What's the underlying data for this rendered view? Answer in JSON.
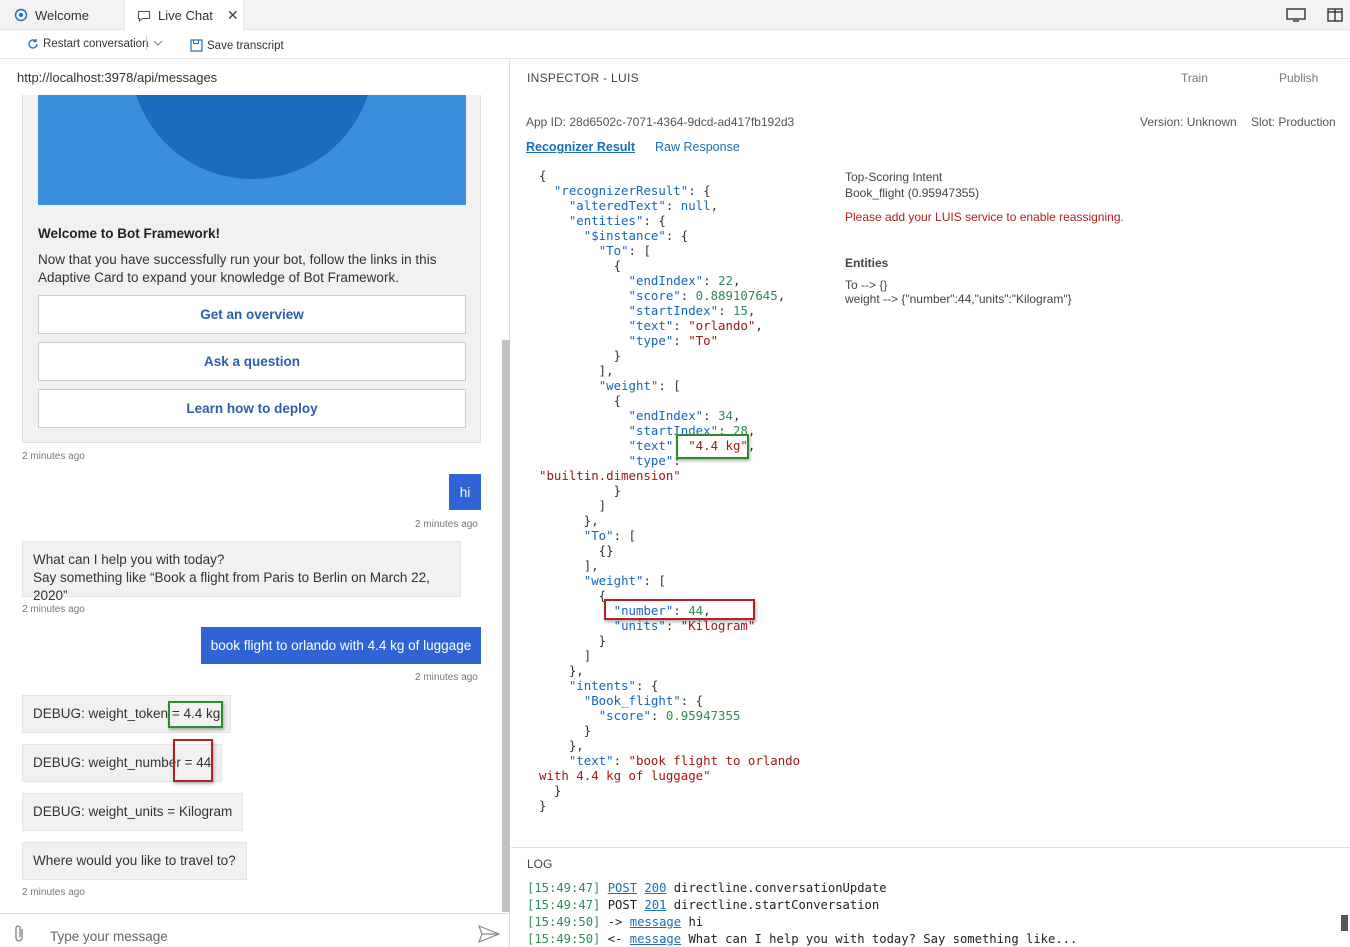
{
  "tabs": [
    {
      "label": "Welcome"
    },
    {
      "label": "Live Chat"
    }
  ],
  "toolbar": {
    "restart_label": "Restart conversation",
    "save_label": "Save transcript"
  },
  "chat": {
    "endpoint": "http://localhost:3978/api/messages",
    "card": {
      "title": "Welcome to Bot Framework!",
      "text": "Now that you have successfully run your bot, follow the links in this Adaptive Card to expand your knowledge of Bot Framework.",
      "buttons": [
        "Get an overview",
        "Ask a question",
        "Learn how to deploy"
      ]
    },
    "messages": [
      {
        "from": "bot",
        "time": "2 minutes ago"
      },
      {
        "from": "user",
        "text": "hi",
        "time": "2 minutes ago"
      },
      {
        "from": "bot",
        "line1": "What can I help you with today?",
        "line2": "Say something like “Book a flight from Paris to Berlin on March 22, 2020”",
        "time": "2 minutes ago"
      },
      {
        "from": "user",
        "text": "book flight to orlando with 4.4 kg of luggage",
        "time": "2 minutes ago"
      },
      {
        "from": "bot",
        "text": "DEBUG: weight_token = 4.4 kg"
      },
      {
        "from": "bot",
        "text": "DEBUG: weight_number = 44"
      },
      {
        "from": "bot",
        "text": "DEBUG: weight_units = Kilogram"
      },
      {
        "from": "bot",
        "text": "Where would you like to travel to?",
        "time": "2 minutes ago"
      }
    ],
    "input_placeholder": "Type your message"
  },
  "inspector": {
    "title": "INSPECTOR - LUIS",
    "train_label": "Train",
    "publish_label": "Publish",
    "app_id": "App ID: 28d6502c-7071-4364-9dcd-ad417fb192d3",
    "version": "Version: Unknown",
    "slot": "Slot: Production",
    "tabs": [
      "Recognizer Result",
      "Raw Response"
    ],
    "top_intent_label": "Top-Scoring Intent",
    "top_intent_value": "Book_flight (0.95947355)",
    "warning": "Please add your LUIS service to enable reassigning.",
    "entities_label": "Entities",
    "entities": [
      "To --> {}",
      "weight --> {\"number\":44,\"units\":\"Kilogram\"}"
    ]
  },
  "log": {
    "title": "LOG",
    "lines": [
      {
        "time": "[15:49:47]",
        "verb": "POST",
        "code": "200",
        "rest": "directline.conversationUpdate"
      },
      {
        "time": "[15:49:47]",
        "verb": "POST",
        "code": "201",
        "rest": "directline.startConversation"
      },
      {
        "time": "[15:49:50]",
        "arrow": "->",
        "link": "message",
        "rest": "hi"
      },
      {
        "time": "[15:49:50]",
        "arrow": "<-",
        "link": "message",
        "rest": "What can I help you with today? Say something like..."
      }
    ]
  },
  "colors": {
    "user_bubble": "#3063d4",
    "card_image": "#3a8fdc",
    "link": "#1a6fb5",
    "warning": "#b22222",
    "highlight_green": "#2d8b2d",
    "highlight_red": "#b22222"
  }
}
